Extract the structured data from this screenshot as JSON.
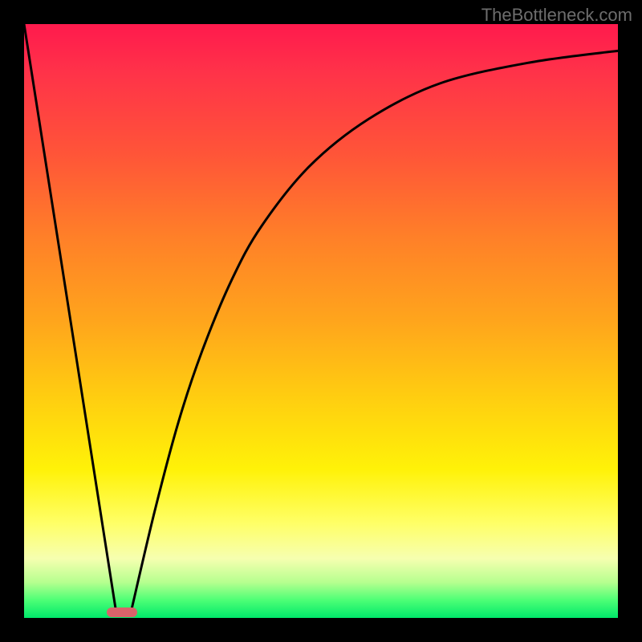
{
  "watermark": "TheBottleneck.com",
  "chart_data": {
    "type": "line",
    "title": "",
    "xlabel": "",
    "ylabel": "",
    "xlim": [
      0,
      100
    ],
    "ylim": [
      0,
      100
    ],
    "grid": false,
    "legend": false,
    "background_gradient": {
      "direction": "vertical",
      "stops": [
        {
          "pos": 0,
          "color": "#ff1a4d",
          "semantic": "bad"
        },
        {
          "pos": 50,
          "color": "#ffa51c",
          "semantic": "warn"
        },
        {
          "pos": 84,
          "color": "#ffff66",
          "semantic": "ok"
        },
        {
          "pos": 100,
          "color": "#00e86a",
          "semantic": "good"
        }
      ]
    },
    "series": [
      {
        "name": "left-line",
        "x": [
          0,
          15.5
        ],
        "y": [
          100,
          1
        ],
        "style": "straight"
      },
      {
        "name": "right-curve",
        "x": [
          18,
          22,
          26,
          30,
          35,
          40,
          48,
          58,
          70,
          85,
          100
        ],
        "y": [
          1,
          18,
          33,
          45,
          57,
          66,
          76,
          84,
          90,
          93.5,
          95.5
        ],
        "style": "monotone-increasing-asymptote"
      }
    ],
    "marker": {
      "shape": "pill",
      "x_center": 16.5,
      "y": 1,
      "width_pct": 5.2,
      "height_pct": 1.6,
      "color": "#d9636a"
    }
  }
}
